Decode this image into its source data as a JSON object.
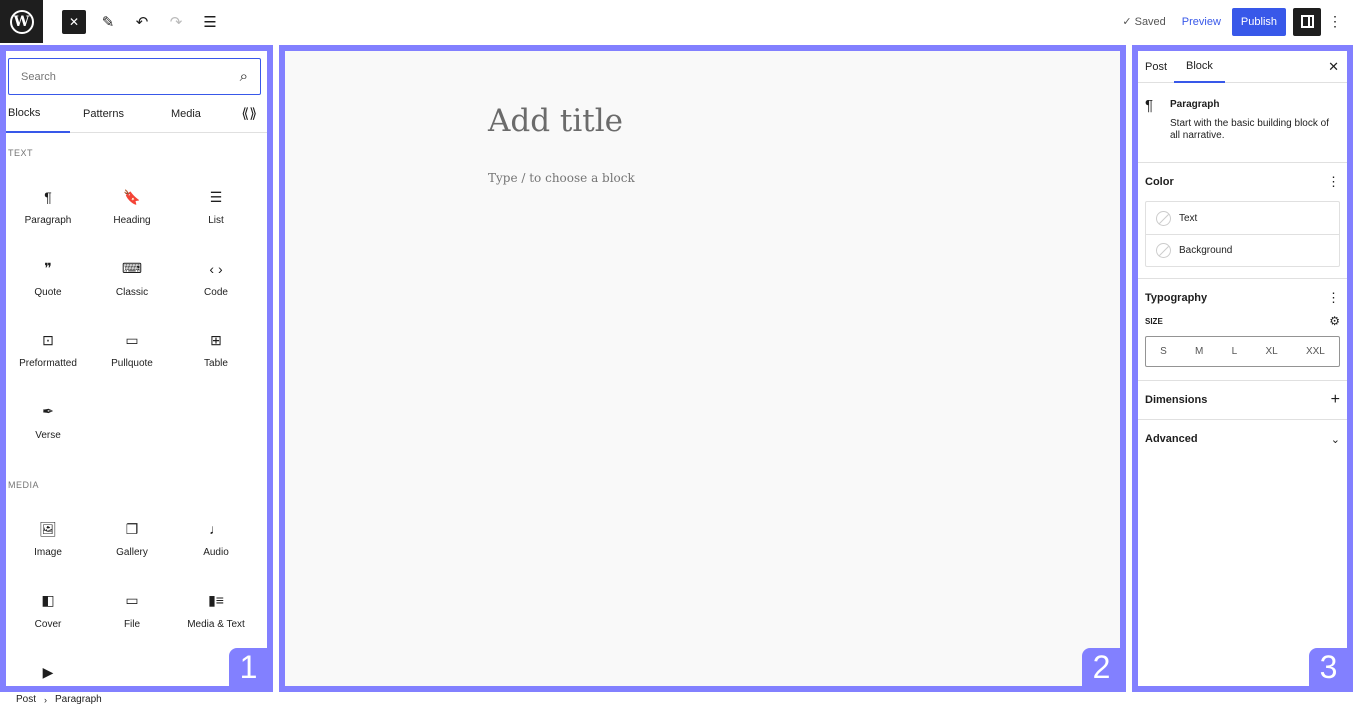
{
  "topbar": {
    "status": "✓ Saved",
    "preview_label": "Preview",
    "publish_label": "Publish",
    "logo_letter": "W"
  },
  "inserter": {
    "search_placeholder": "Search",
    "tabs": [
      "Blocks",
      "Patterns",
      "Media"
    ],
    "sections": [
      {
        "title": "TEXT",
        "blocks": [
          {
            "label": "Paragraph",
            "icon": "¶"
          },
          {
            "label": "Heading",
            "icon": "🔖"
          },
          {
            "label": "List",
            "icon": "☰"
          },
          {
            "label": "Quote",
            "icon": "❞"
          },
          {
            "label": "Classic",
            "icon": "⌨"
          },
          {
            "label": "Code",
            "icon": "‹ ›"
          },
          {
            "label": "Preformatted",
            "icon": "⊡"
          },
          {
            "label": "Pullquote",
            "icon": "▭"
          },
          {
            "label": "Table",
            "icon": "⊞"
          },
          {
            "label": "Verse",
            "icon": "✒"
          }
        ]
      },
      {
        "title": "MEDIA",
        "blocks": [
          {
            "label": "Image",
            "icon": "🖼"
          },
          {
            "label": "Gallery",
            "icon": "❐"
          },
          {
            "label": "Audio",
            "icon": "♩"
          },
          {
            "label": "Cover",
            "icon": "◧"
          },
          {
            "label": "File",
            "icon": "▭"
          },
          {
            "label": "Media & Text",
            "icon": "▮≡"
          },
          {
            "label": "",
            "icon": "▶"
          }
        ]
      }
    ]
  },
  "canvas": {
    "title_placeholder": "Add title",
    "block_hint": "Type / to choose a block"
  },
  "sidebar": {
    "tabs": [
      "Post",
      "Block"
    ],
    "block_name": "Paragraph",
    "block_description": "Start with the basic building block of all narrative.",
    "color_heading": "Color",
    "color_items": [
      "Text",
      "Background"
    ],
    "typography_heading": "Typography",
    "size_label": "SIZE",
    "sizes": [
      "S",
      "M",
      "L",
      "XL",
      "XXL"
    ],
    "dimensions_heading": "Dimensions",
    "advanced_heading": "Advanced"
  },
  "badges": [
    "1",
    "2",
    "3"
  ],
  "footer": {
    "breadcrumb": [
      "Post",
      "Paragraph"
    ]
  },
  "colors": {
    "accent": "#3858e9",
    "frame": "#8280ff",
    "dark": "#1e1e1e"
  }
}
